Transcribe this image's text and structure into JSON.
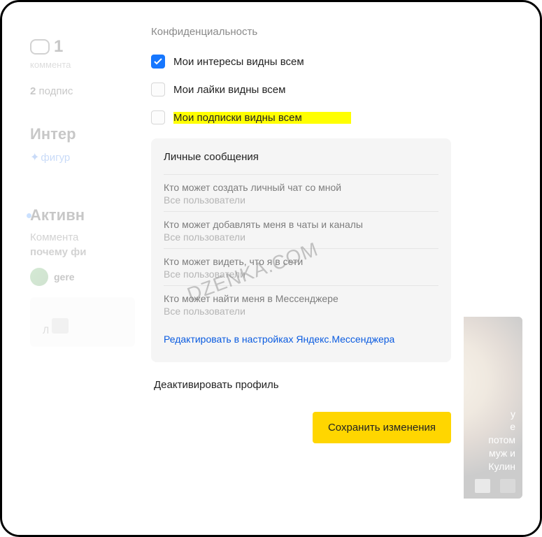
{
  "page": {
    "comments_count": "1",
    "comments_label": "коммента",
    "subs_count": "2",
    "subs_label": "подпис",
    "interests_heading": "Интер",
    "interests_link": "фигур",
    "activity_heading": "Активн",
    "comment_line": "Коммента",
    "comment_line2": "почему фи",
    "username": "gere",
    "pane_l_text": "Л",
    "thumb_text": "у\nе\nпотом\nмуж и\nКулин"
  },
  "modal": {
    "section_title": "Конфиденциальность",
    "checkboxes": [
      {
        "label": "Мои интересы видны всем",
        "checked": true,
        "highlight": false
      },
      {
        "label": "Мои лайки видны всем",
        "checked": false,
        "highlight": false
      },
      {
        "label": "Мои подписки видны всем",
        "checked": false,
        "highlight": true
      }
    ],
    "pm_heading": "Личные сообщения",
    "pm_items": [
      {
        "q": "Кто может создать личный чат со мной",
        "a": "Все пользователи"
      },
      {
        "q": "Кто может добавлять меня в чаты и каналы",
        "a": "Все пользователи"
      },
      {
        "q": "Кто может видеть, что я в сети",
        "a": "Все пользователи"
      },
      {
        "q": "Кто может найти меня в Мессенджере",
        "a": "Все пользователи"
      }
    ],
    "edit_link": "Редактировать в настройках Яндекс.Мессенджера",
    "deactivate": "Деактивировать профиль",
    "save": "Сохранить изменения"
  },
  "watermark": "DZENKA.COM"
}
